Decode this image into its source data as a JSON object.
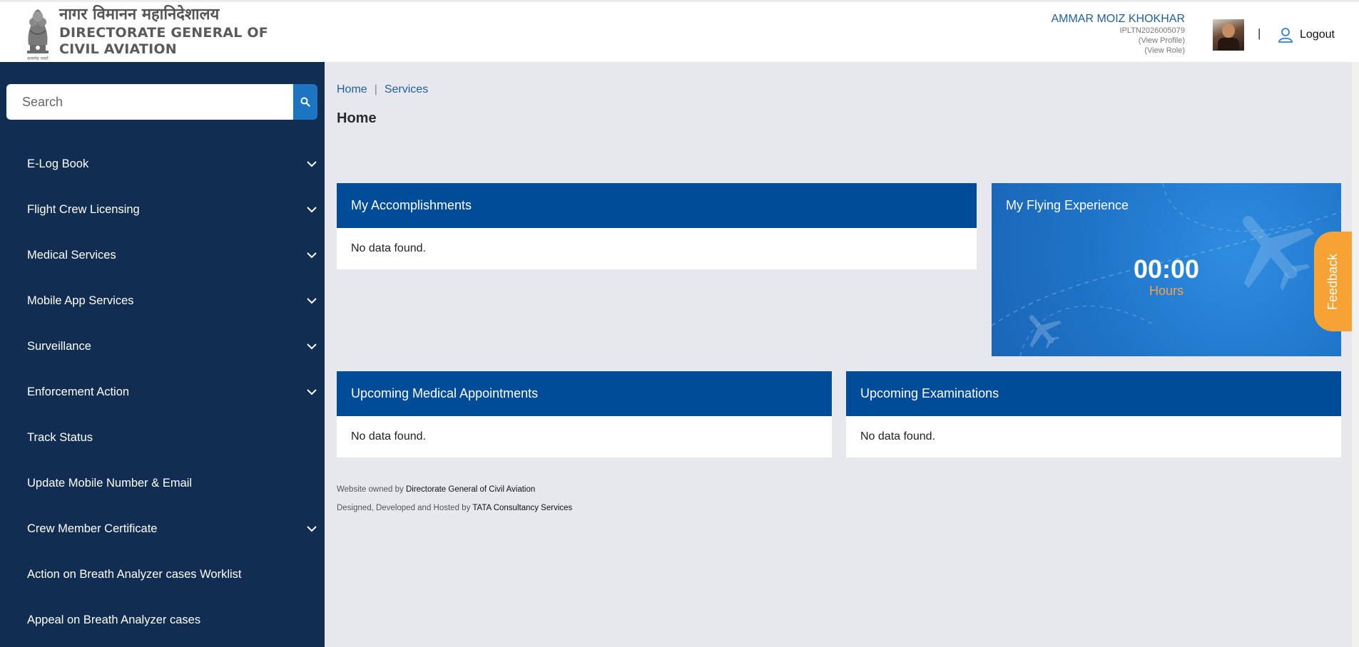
{
  "header": {
    "logo_hindi": "नागर विमानन महानिदेशालय",
    "logo_line1": "DIRECTORATE GENERAL OF",
    "logo_line2": "CIVIL AVIATION",
    "user_name": "AMMAR MOIZ KHOKHAR",
    "user_id": "IPLTN2026005079",
    "view_profile": "(View Profile)",
    "view_role": "(View Role)",
    "separator": "|",
    "logout_label": "Logout"
  },
  "sidebar": {
    "search_placeholder": "Search",
    "items": [
      {
        "label": "E-Log Book",
        "expandable": true
      },
      {
        "label": "Flight Crew Licensing",
        "expandable": true
      },
      {
        "label": "Medical Services",
        "expandable": true
      },
      {
        "label": "Mobile App Services",
        "expandable": true
      },
      {
        "label": "Surveillance",
        "expandable": true
      },
      {
        "label": "Enforcement Action",
        "expandable": true
      },
      {
        "label": "Track Status",
        "expandable": false
      },
      {
        "label": "Update Mobile Number & Email",
        "expandable": false
      },
      {
        "label": "Crew Member Certificate",
        "expandable": true
      },
      {
        "label": "Action on Breath Analyzer cases Worklist",
        "expandable": false
      },
      {
        "label": "Appeal on Breath Analyzer cases",
        "expandable": false
      }
    ]
  },
  "breadcrumb": {
    "home": "Home",
    "separator": "|",
    "services": "Services"
  },
  "page_title": "Home",
  "cards": {
    "accomplishments": {
      "title": "My Accomplishments",
      "body": "No data found."
    },
    "flying": {
      "title": "My Flying Experience",
      "value": "00:00",
      "unit": "Hours"
    },
    "medical": {
      "title": "Upcoming Medical Appointments",
      "body": "No data found."
    },
    "exams": {
      "title": "Upcoming Examinations",
      "body": "No data found."
    }
  },
  "feedback_label": "Feedback",
  "footer": {
    "owned_prefix": "Website owned by ",
    "owned_org": "Directorate General of Civil Aviation",
    "designed_prefix": "Designed, Developed and Hosted by ",
    "designed_org": "TATA Consultancy Services"
  },
  "colors": {
    "sidebar_bg": "#112e52",
    "card_header": "#004c99",
    "accent_orange": "#f7a234",
    "link_blue": "#1f5f9e"
  }
}
